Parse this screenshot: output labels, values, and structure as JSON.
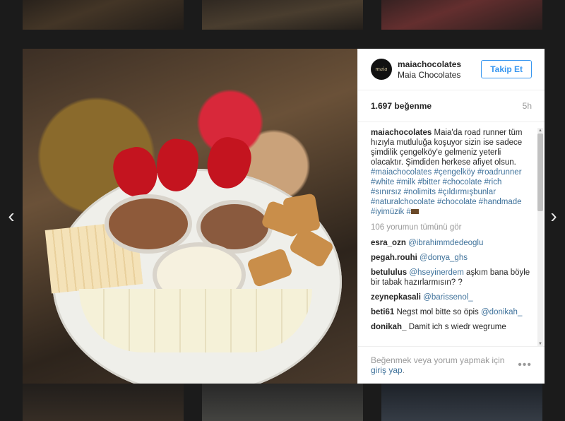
{
  "post": {
    "username": "maiachocolates",
    "full_name": "Maia Chocolates",
    "follow_label": "Takip Et",
    "avatar_text": "maia",
    "likes": "1.697 beğenme",
    "time": "5h",
    "caption": {
      "author": "maiachocolates",
      "text": "Maia'da road runner tüm hızıyla mutluluğa koşuyor sizin ise sadece şimdilik çengelköy'e gelmeniz yeterli olacaktır. Şimdiden herkese afiyet olsun.",
      "hashtags": "#maiachocolates #çengelköy #roadrunner #white #milk #bitter #chocolate #rich #sınırsız #nolimits #çıldırmışbunlar #naturalchocolate #chocolate #handmade #iyimüzik #"
    },
    "view_all_comments": "106 yorumun tümünü gör",
    "comments": [
      {
        "user": "esra_ozn",
        "text": "",
        "mention": "@ibrahimmdedeoglu"
      },
      {
        "user": "pegah.rouhi",
        "text": "",
        "mention": "@donya_ghs"
      },
      {
        "user": "betululus",
        "text": "aşkım bana böyle bir tabak hazırlarmısın? ?",
        "mention": "@hseyinerdem"
      },
      {
        "user": "zeynepkasali",
        "text": "",
        "mention": "@barissenol_"
      },
      {
        "user": "beti61",
        "text": "Negst mol bitte so öpis",
        "mention": "@donikah_"
      },
      {
        "user": "donikah_",
        "text": "Damit ich s wiedr wegrume",
        "mention": ""
      }
    ],
    "footer_text": "Beğenmek veya yorum yapmak için",
    "footer_login": "giriş yap",
    "footer_dot": "."
  },
  "icons": {
    "prev": "chevron-left-icon",
    "next": "chevron-right-icon",
    "more": "more-options-icon"
  },
  "colors": {
    "accent": "#3897f0",
    "link": "#3f729b"
  }
}
